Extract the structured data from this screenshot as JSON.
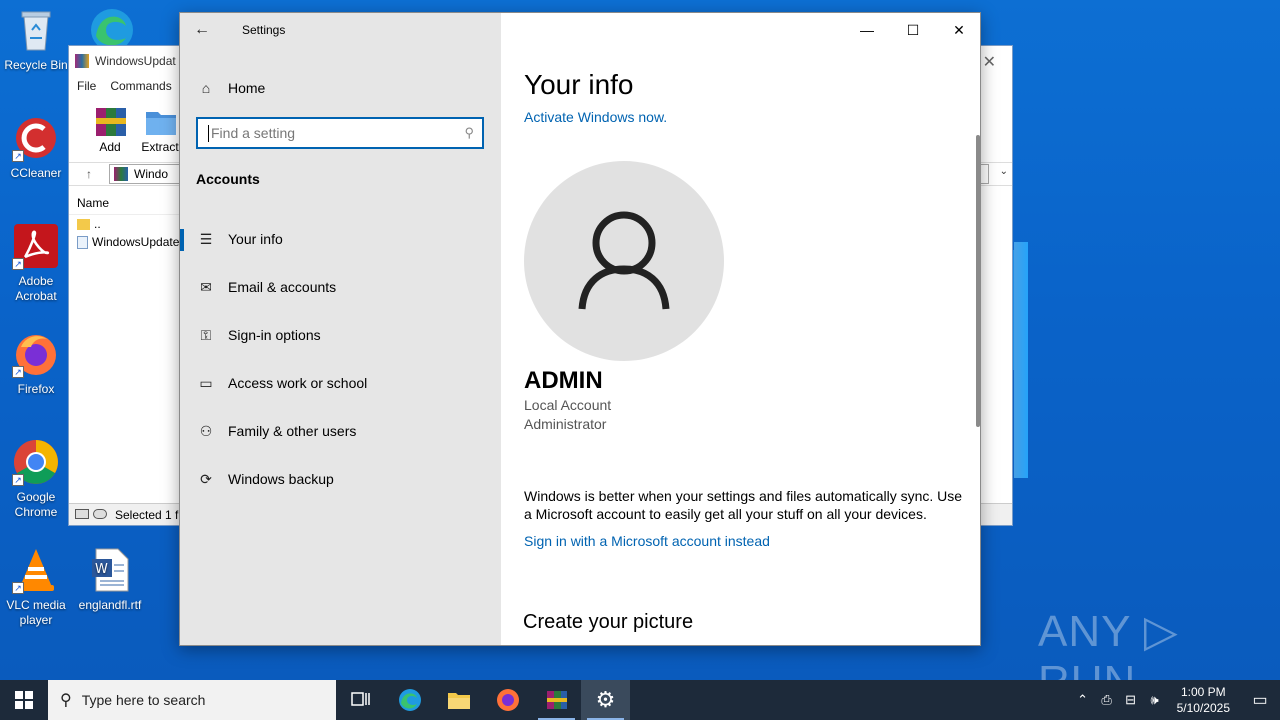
{
  "desktop": {
    "icons": [
      {
        "label": "Recycle Bin"
      },
      {
        "label": "CCleaner"
      },
      {
        "label": "Adobe Acrobat"
      },
      {
        "label": "Firefox"
      },
      {
        "label": "Google Chrome"
      },
      {
        "label": "VLC media player"
      },
      {
        "label": "englandfl.rtf"
      }
    ],
    "watermark": "ANY ▷ RUN"
  },
  "winrar": {
    "title": "WindowsUpdat",
    "menu": [
      "File",
      "Commands"
    ],
    "tools": [
      "Add",
      "Extract"
    ],
    "address": "Windo",
    "column_name": "Name",
    "rows": [
      "..",
      "WindowsUpdate"
    ],
    "status": "Selected 1 fi"
  },
  "settings": {
    "window_title": "Settings",
    "nav": {
      "home": "Home",
      "search_placeholder": "Find a setting",
      "section": "Accounts",
      "items": [
        {
          "label": "Your info",
          "icon": "person-card-icon",
          "selected": true
        },
        {
          "label": "Email & accounts",
          "icon": "mail-icon"
        },
        {
          "label": "Sign-in options",
          "icon": "key-icon"
        },
        {
          "label": "Access work or school",
          "icon": "briefcase-icon"
        },
        {
          "label": "Family & other users",
          "icon": "person-add-icon"
        },
        {
          "label": "Windows backup",
          "icon": "sync-icon"
        }
      ]
    },
    "main": {
      "heading": "Your info",
      "activate_link": "Activate Windows now.",
      "user_name": "ADMIN",
      "account_type": "Local Account",
      "role": "Administrator",
      "sync_message": "Windows is better when your settings and files automatically sync. Use a Microsoft account to easily get all your stuff on all your devices.",
      "signin_link": "Sign in with a Microsoft account instead",
      "picture_heading": "Create your picture"
    }
  },
  "taskbar": {
    "search_placeholder": "Type here to search",
    "time": "1:00 PM",
    "date": "5/10/2025"
  },
  "colors": {
    "accent": "#0063b1",
    "desktop": "#0a63c9",
    "taskbar": "#1d2a3a",
    "nav_bg": "#e6e6e6"
  }
}
